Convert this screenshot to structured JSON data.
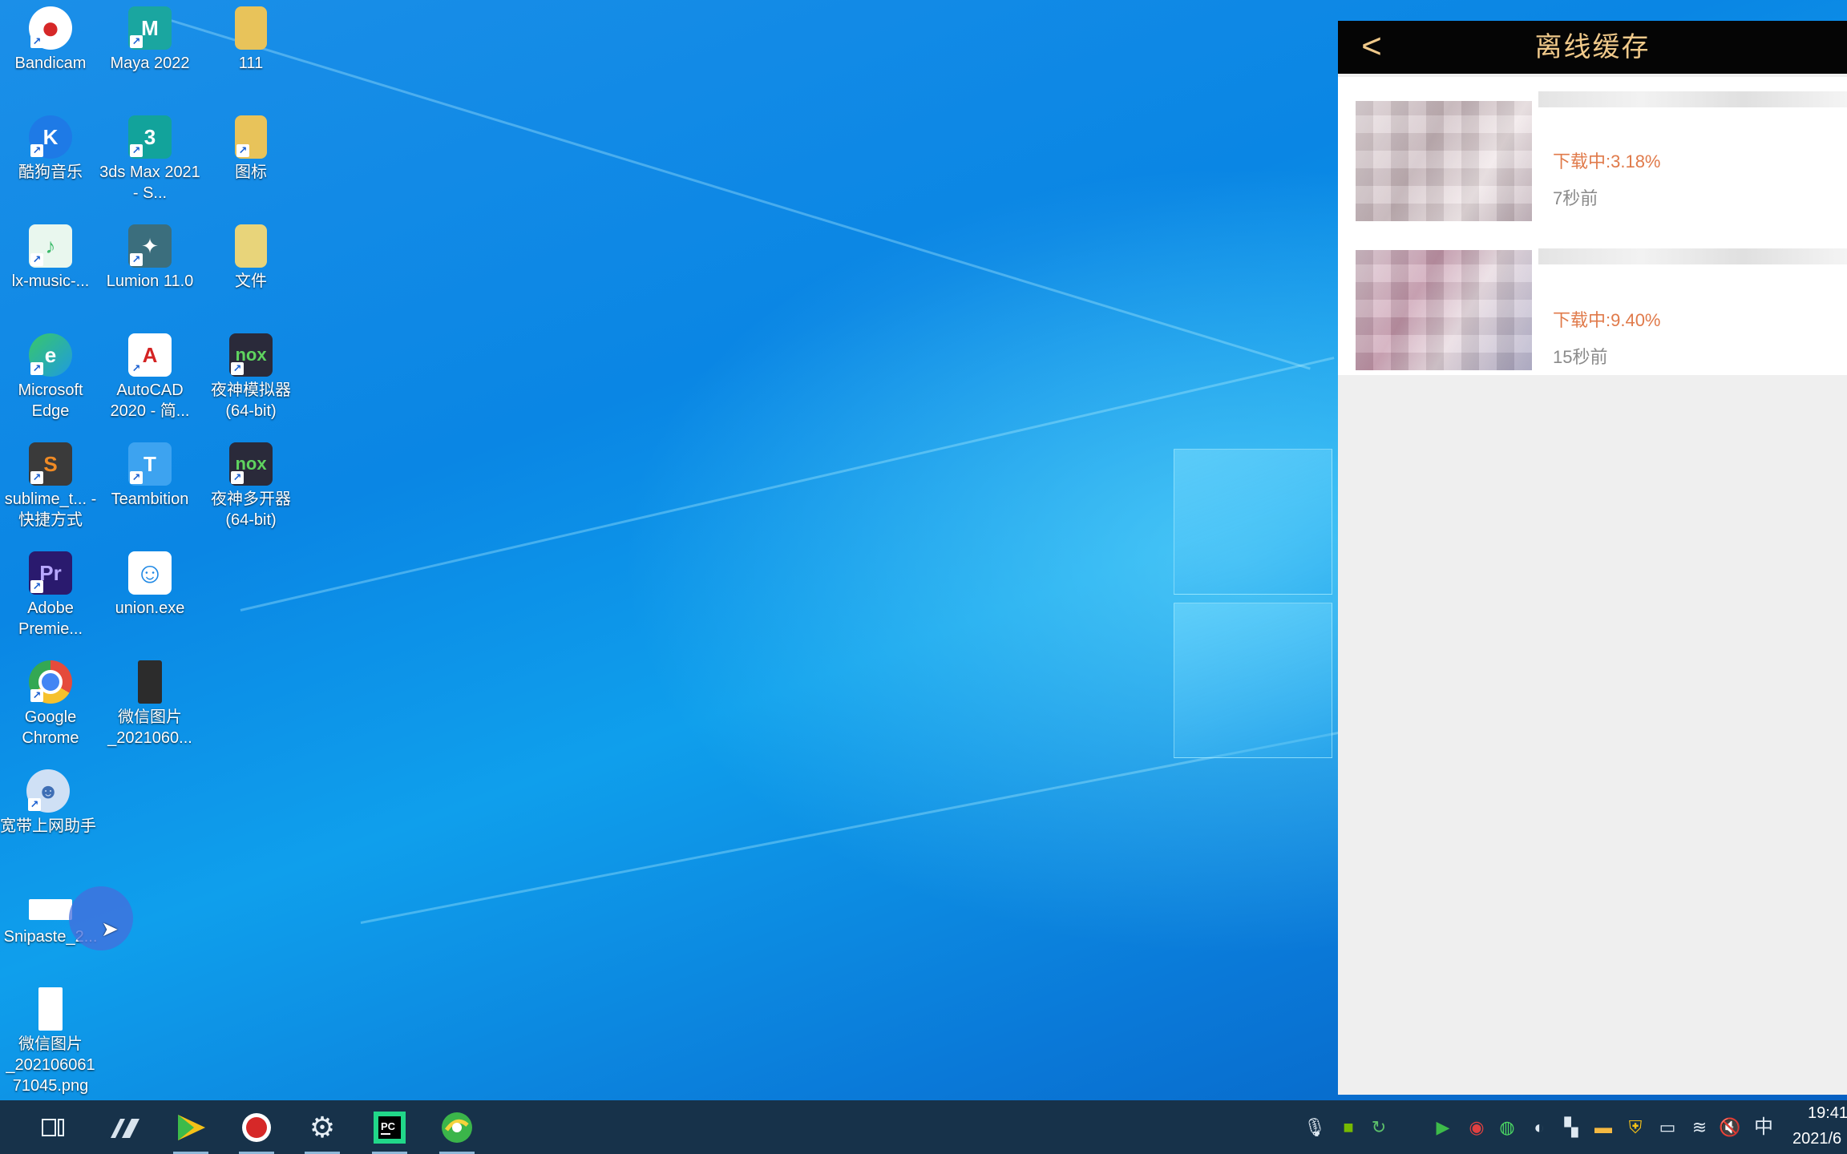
{
  "desktop": {
    "icons": [
      {
        "label": "Bandicam",
        "glyph": "●",
        "color": "#d62828"
      },
      {
        "label": "Maya 2022",
        "glyph": "M",
        "color": "#1aa6a0"
      },
      {
        "label": "111",
        "glyph": "▮",
        "color": "#e8c35a"
      },
      {
        "label": "酷狗音乐",
        "glyph": "K",
        "color": "#1e7ae6"
      },
      {
        "label": "3ds Max 2021 - S...",
        "glyph": "3",
        "color": "#12a39b"
      },
      {
        "label": "图标",
        "glyph": "▮",
        "color": "#e8c35a"
      },
      {
        "label": "lx-music-...",
        "glyph": "♪",
        "color": "#3dbb6b"
      },
      {
        "label": "Lumion 11.0",
        "glyph": "✦",
        "color": "#3b6e7d"
      },
      {
        "label": "文件",
        "glyph": "▮",
        "color": "#e8d47a"
      },
      {
        "label": "Microsoft Edge",
        "glyph": "e",
        "color": "#1f9be0"
      },
      {
        "label": "AutoCAD 2020 - 简...",
        "glyph": "A",
        "color": "#d42323"
      },
      {
        "label": "夜神模拟器 (64-bit)",
        "glyph": "nox",
        "color": "#2a2a3a"
      },
      {
        "label": "sublime_t... - 快捷方式",
        "glyph": "S",
        "color": "#f08a24"
      },
      {
        "label": "Teambition",
        "glyph": "T",
        "color": "#3da3f0"
      },
      {
        "label": "夜神多开器 (64-bit)",
        "glyph": "nox",
        "color": "#2a2a3a"
      },
      {
        "label": "Adobe Premie...",
        "glyph": "Pr",
        "color": "#2a1a6e"
      },
      {
        "label": "union.exe",
        "glyph": "☺",
        "color": "#ffffff"
      },
      {
        "label": "Google Chrome",
        "glyph": "◉",
        "color": "#e54b3b"
      },
      {
        "label": "微信图片 _2021060...",
        "glyph": "▭",
        "color": "#333333"
      },
      {
        "label": "宽带上网助手",
        "glyph": "☻",
        "color": "#3f6fb5"
      },
      {
        "label": "Snipaste_2...",
        "glyph": "▭",
        "color": "#ffffff"
      },
      {
        "label": "微信图片 _202106061 71045.png",
        "glyph": "▯",
        "color": "#ffffff"
      }
    ]
  },
  "app": {
    "title": "离线缓存",
    "back_glyph": "<",
    "items": [
      {
        "status": "下载中:3.18%",
        "time": "7秒前"
      },
      {
        "status": "下载中:9.40%",
        "time": "15秒前"
      }
    ]
  },
  "taskbar": {
    "time": "19:41",
    "date": "2021/6",
    "ime": "中",
    "apps": [
      "task-view",
      "maya-launcher",
      "media-player",
      "bandicam",
      "settings",
      "pycharm",
      "browser-360"
    ],
    "tray_icons": [
      "microphone-icon",
      "nvidia-icon",
      "sync-icon",
      "player-icon",
      "record-icon",
      "wechat-icon",
      "globe-icon",
      "bookmark-icon",
      "folder-icon",
      "shield-icon",
      "battery-icon",
      "wifi-icon",
      "volume-muted-icon"
    ]
  }
}
